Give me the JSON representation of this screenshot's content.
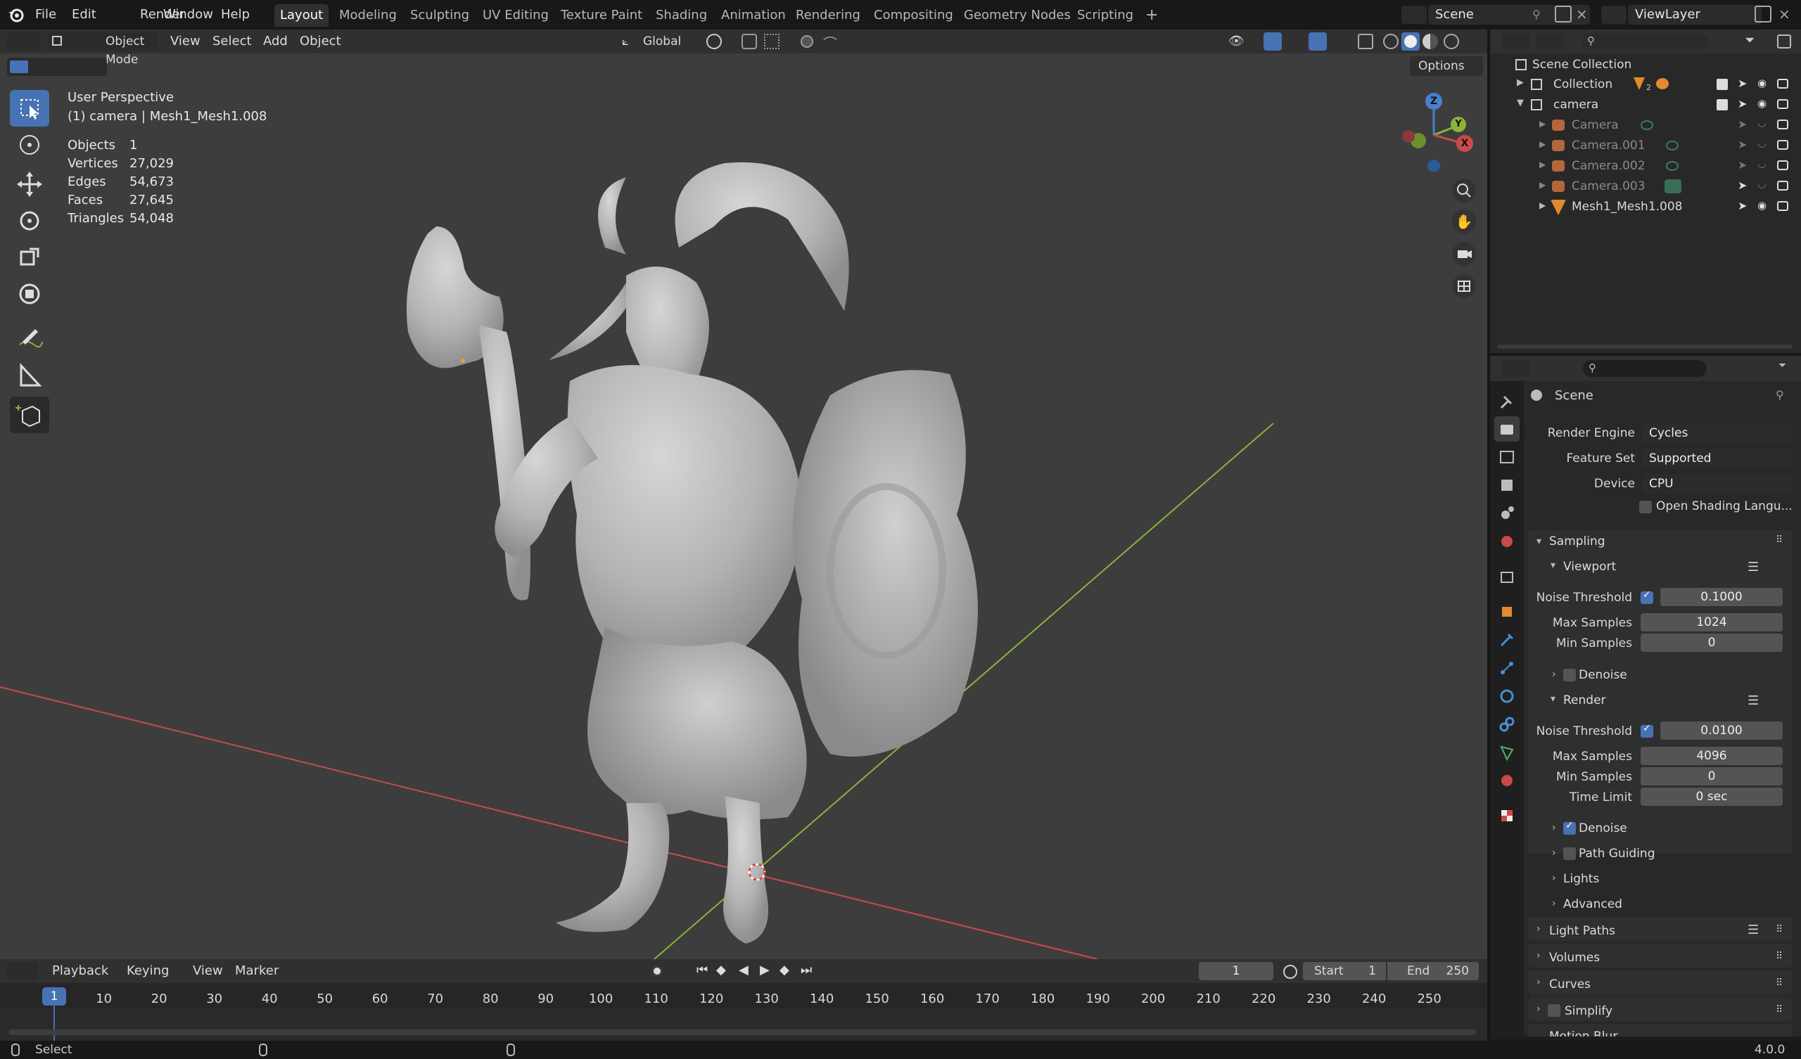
{
  "topbar": {
    "menu": [
      "File",
      "Edit",
      "Render",
      "Window",
      "Help"
    ],
    "workspaces": [
      "Layout",
      "Modeling",
      "Sculpting",
      "UV Editing",
      "Texture Paint",
      "Shading",
      "Animation",
      "Rendering",
      "Compositing",
      "Geometry Nodes",
      "Scripting"
    ],
    "active_workspace": "Layout",
    "add_tab": "+",
    "scene_name": "Scene",
    "view_layer": "ViewLayer"
  },
  "viewport_header": {
    "mode": "Object Mode",
    "menus": [
      "View",
      "Select",
      "Add",
      "Object"
    ],
    "transform_orientation": "Global",
    "options_label": "Options"
  },
  "viewport": {
    "view_name": "User Perspective",
    "context": "(1) camera | Mesh1_Mesh1.008",
    "stats": [
      {
        "label": "Objects",
        "value": "1"
      },
      {
        "label": "Vertices",
        "value": "27,029"
      },
      {
        "label": "Edges",
        "value": "54,673"
      },
      {
        "label": "Faces",
        "value": "27,645"
      },
      {
        "label": "Triangles",
        "value": "54,048"
      }
    ],
    "gizmo_axes": {
      "z": "Z",
      "y": "Y",
      "x": "X"
    }
  },
  "outliner": {
    "root": "Scene Collection",
    "items": [
      {
        "label": "Collection",
        "level": 1,
        "expanded": false,
        "badge": "2"
      },
      {
        "label": "camera",
        "level": 1,
        "expanded": true
      },
      {
        "label": "Camera",
        "level": 2
      },
      {
        "label": "Camera.001",
        "level": 2
      },
      {
        "label": "Camera.002",
        "level": 2
      },
      {
        "label": "Camera.003",
        "level": 2
      },
      {
        "label": "Mesh1_Mesh1.008",
        "level": 2
      }
    ]
  },
  "properties": {
    "context": "Scene",
    "render_engine_label": "Render Engine",
    "render_engine": "Cycles",
    "feature_set_label": "Feature Set",
    "feature_set": "Supported",
    "device_label": "Device",
    "device": "CPU",
    "osl_label": "Open Shading Langu...",
    "sampling": "Sampling",
    "viewport": "Viewport",
    "vp_noise_label": "Noise Threshold",
    "vp_noise": "0.1000",
    "vp_max_label": "Max Samples",
    "vp_max": "1024",
    "vp_min_label": "Min Samples",
    "vp_min": "0",
    "vp_denoise": "Denoise",
    "render": "Render",
    "r_noise_label": "Noise Threshold",
    "r_noise": "0.0100",
    "r_max_label": "Max Samples",
    "r_max": "4096",
    "r_min_label": "Min Samples",
    "r_min": "0",
    "r_time_label": "Time Limit",
    "r_time": "0 sec",
    "r_denoise": "Denoise",
    "path_guiding": "Path Guiding",
    "lights": "Lights",
    "advanced": "Advanced",
    "light_paths": "Light Paths",
    "volumes": "Volumes",
    "curves": "Curves",
    "simplify": "Simplify",
    "motion_blur": "Motion Blur"
  },
  "timeline": {
    "menus": [
      "Playback",
      "Keying",
      "View",
      "Marker"
    ],
    "current_frame": "1",
    "start_label": "Start",
    "start": "1",
    "end_label": "End",
    "end": "250",
    "ruler": [
      "1",
      "10",
      "20",
      "30",
      "40",
      "50",
      "60",
      "70",
      "80",
      "90",
      "100",
      "110",
      "120",
      "130",
      "140",
      "150",
      "160",
      "170",
      "180",
      "190",
      "200",
      "210",
      "220",
      "230",
      "240",
      "250"
    ]
  },
  "statusbar": {
    "left": "Select",
    "version": "4.0.0"
  },
  "colors": {
    "accent": "#4772b3",
    "x_axis": "#c94a4a",
    "y_axis": "#8bb33a",
    "z_axis": "#4a7fd1",
    "viewport_bg": "#3d3d3d"
  }
}
